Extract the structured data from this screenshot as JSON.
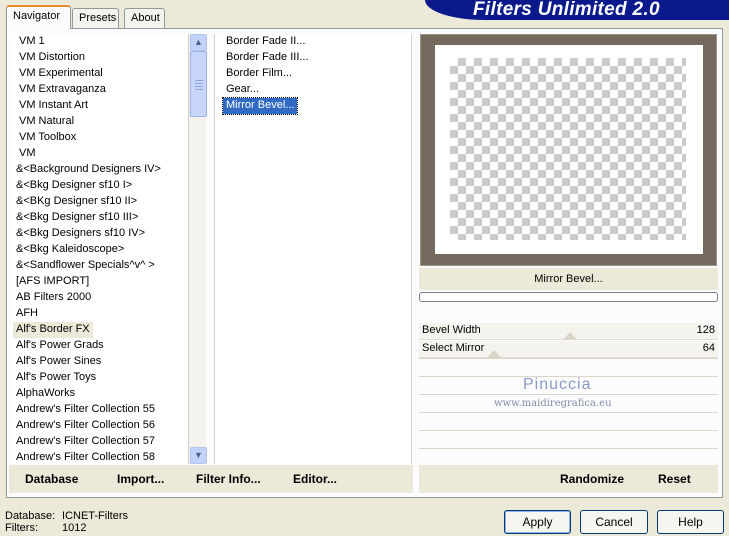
{
  "tabs": [
    {
      "label": "Navigator",
      "active": true
    },
    {
      "label": "Presets",
      "active": false
    },
    {
      "label": "About",
      "active": false
    }
  ],
  "banner": {
    "title": "Filters Unlimited 2.0"
  },
  "categories": {
    "items": [
      "VM 1",
      "VM Distortion",
      "VM Experimental",
      "VM Extravaganza",
      "VM Instant Art",
      "VM Natural",
      "VM Toolbox",
      "VM",
      "&<Background Designers IV>",
      "&<Bkg Designer sf10 I>",
      "&<BKg Designer sf10 II>",
      "&<Bkg Designer sf10 III>",
      "&<Bkg Designers sf10 IV>",
      "&<Bkg Kaleidoscope>",
      "&<Sandflower Specials^v^ >",
      "[AFS IMPORT]",
      "AB Filters 2000",
      "AFH",
      "Alf's Border FX",
      "Alf's Power Grads",
      "Alf's Power Sines",
      "Alf's Power Toys",
      "AlphaWorks",
      "Andrew's Filter Collection 55",
      "Andrew's Filter Collection 56",
      "Andrew's Filter Collection 57",
      "Andrew's Filter Collection 58"
    ],
    "selected": "Alf's Border FX"
  },
  "filters": {
    "items": [
      "Border Fade II...",
      "Border Fade III...",
      "Border Film...",
      "Gear...",
      "Mirror Bevel..."
    ],
    "selected": "Mirror Bevel..."
  },
  "preview": {
    "filter_name": "Mirror Bevel...",
    "border_color": "#75685c"
  },
  "params": [
    {
      "label": "Bevel Width",
      "value": "128",
      "level": 0.5
    },
    {
      "label": "Select Mirror",
      "value": "64",
      "level": 0.25
    }
  ],
  "watermark": {
    "line1": "Pinuccia",
    "line2": "www.maidiregrafica.eu"
  },
  "toolbar": {
    "database": "Database",
    "import": "Import...",
    "filter_info": "Filter Info...",
    "editor": "Editor...",
    "randomize": "Randomize",
    "reset": "Reset"
  },
  "status": {
    "database_label": "Database:",
    "database_value": "ICNET-Filters",
    "filters_label": "Filters:",
    "filters_value": "1012"
  },
  "buttons": {
    "apply": "Apply",
    "cancel": "Cancel",
    "help": "Help"
  },
  "colors": {
    "selection": "#316ac5",
    "banner": "#0a1a8c",
    "tab_accent": "#e68b2c"
  }
}
